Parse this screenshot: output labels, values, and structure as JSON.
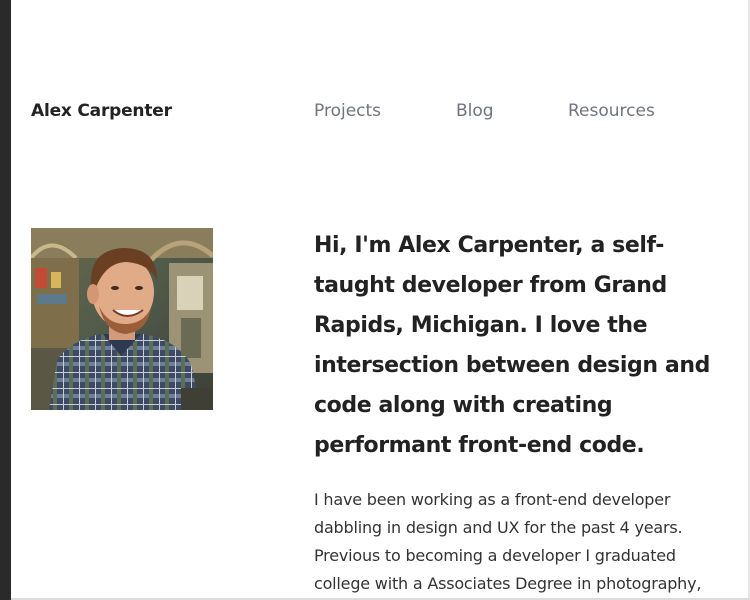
{
  "header": {
    "site_title": "Alex Carpenter",
    "nav": [
      {
        "label": "Projects"
      },
      {
        "label": "Blog"
      },
      {
        "label": "Resources"
      }
    ]
  },
  "main": {
    "intro_heading": "Hi, I'm Alex Carpenter, a self-taught developer from Grand Rapids, Michigan. I love the intersection between design and code along with creating performant front-end code.",
    "intro_body": "I have been working as a front-end developer dabbling in design and UX for the past 4 years. Previous to becoming a developer I graduated college with a Associates Degree in photography,"
  },
  "colors": {
    "text": "#222222",
    "nav_text": "#707480",
    "left_bar": "#2a2a2a",
    "background": "#ffffff"
  }
}
